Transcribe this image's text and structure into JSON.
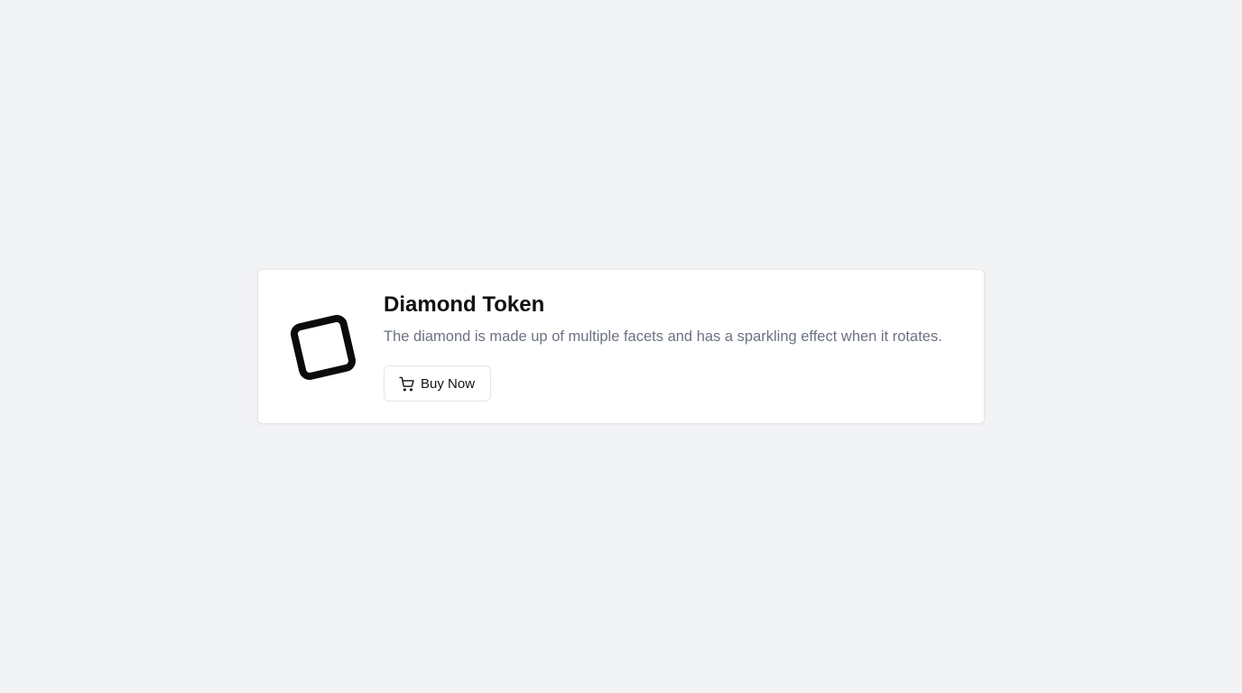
{
  "product": {
    "title": "Diamond Token",
    "description": "The diamond is made up of multiple facets and has a sparkling effect when it rotates.",
    "image_icon": "rounded-square-diamond-icon"
  },
  "actions": {
    "buy_label": "Buy Now",
    "buy_icon": "shopping-cart-icon"
  },
  "colors": {
    "background": "#f2f3f5",
    "card": "#ffffff",
    "title": "#111111",
    "description": "#6b7280",
    "border": "#e3e5e8"
  }
}
